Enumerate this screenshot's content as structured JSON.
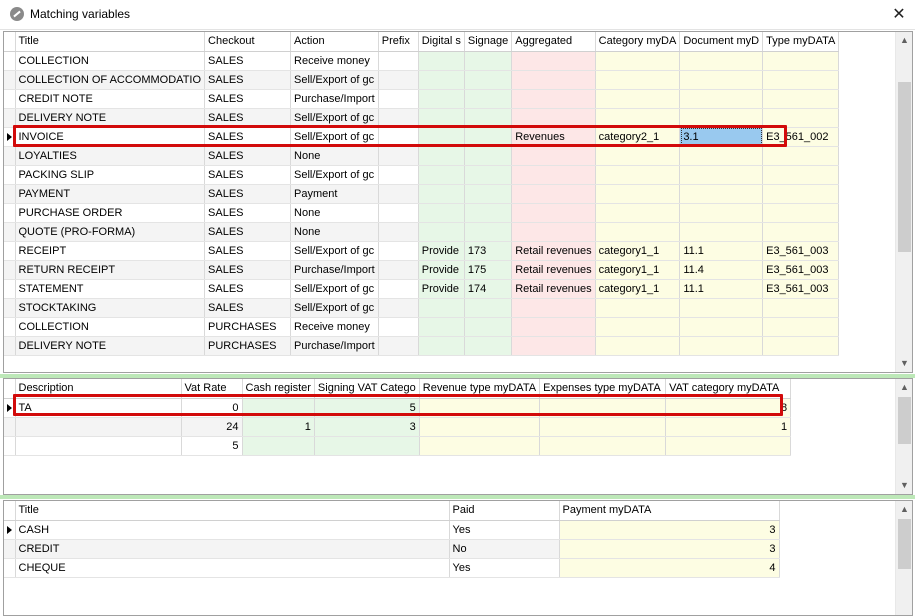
{
  "window": {
    "title": "Matching variables",
    "icon": "no-entry-icon",
    "close_glyph": "✕"
  },
  "documents": {
    "headers": [
      "Title",
      "Checkout",
      "Action",
      "Prefix",
      "Digital s",
      "Signage",
      "Aggregated",
      "Category myDA",
      "Document myD",
      "Type myDATA"
    ],
    "rows": [
      [
        "COLLECTION",
        "SALES",
        "Receive money",
        "",
        "",
        "",
        "",
        "",
        "",
        ""
      ],
      [
        "COLLECTION OF ACCOMMODATIO",
        "SALES",
        "Sell/Export of gc",
        "",
        "",
        "",
        "",
        "",
        "",
        ""
      ],
      [
        "CREDIT NOTE",
        "SALES",
        "Purchase/Import",
        "",
        "",
        "",
        "",
        "",
        "",
        ""
      ],
      [
        "DELIVERY NOTE",
        "SALES",
        "Sell/Export of gc",
        "",
        "",
        "",
        "",
        "",
        "",
        ""
      ],
      [
        "INVOICE",
        "SALES",
        "Sell/Export of gc",
        "",
        "",
        "",
        "Revenues",
        "category2_1",
        "3.1",
        "E3_561_002"
      ],
      [
        "LOYALTIES",
        "SALES",
        "None",
        "",
        "",
        "",
        "",
        "",
        "",
        ""
      ],
      [
        "PACKING SLIP",
        "SALES",
        "Sell/Export of gc",
        "",
        "",
        "",
        "",
        "",
        "",
        ""
      ],
      [
        "PAYMENT",
        "SALES",
        "Payment",
        "",
        "",
        "",
        "",
        "",
        "",
        ""
      ],
      [
        "PURCHASE ORDER",
        "SALES",
        "None",
        "",
        "",
        "",
        "",
        "",
        "",
        ""
      ],
      [
        "QUOTE (PRO-FORMA)",
        "SALES",
        "None",
        "",
        "",
        "",
        "",
        "",
        "",
        ""
      ],
      [
        "RECEIPT",
        "SALES",
        "Sell/Export of gc",
        "",
        "Provide",
        "173",
        "Retail revenues",
        "category1_1",
        "11.1",
        "E3_561_003"
      ],
      [
        "RETURN RECEIPT",
        "SALES",
        "Purchase/Import",
        "",
        "Provide",
        "175",
        "Retail revenues",
        "category1_1",
        "11.4",
        "E3_561_003"
      ],
      [
        "STATEMENT",
        "SALES",
        "Sell/Export of gc",
        "",
        "Provide",
        "174",
        "Retail revenues",
        "category1_1",
        "11.1",
        "E3_561_003"
      ],
      [
        "STOCKTAKING",
        "SALES",
        "Sell/Export of gc",
        "",
        "",
        "",
        "",
        "",
        "",
        ""
      ],
      [
        "COLLECTION",
        "PURCHASES",
        "Receive money",
        "",
        "",
        "",
        "",
        "",
        "",
        ""
      ],
      [
        "DELIVERY NOTE",
        "PURCHASES",
        "Purchase/Import",
        "",
        "",
        "",
        "",
        "",
        "",
        ""
      ]
    ],
    "current_row": 4
  },
  "vat": {
    "headers": [
      "Description",
      "Vat Rate",
      "Cash register",
      "Signing VAT Catego",
      "Revenue type myDATA",
      "Expenses type myDATA",
      "VAT category myDATA"
    ],
    "rows": [
      [
        "TA",
        "0",
        "",
        "5",
        "",
        "",
        "8"
      ],
      [
        "",
        "24",
        "1",
        "3",
        "",
        "",
        "1"
      ],
      [
        "",
        "5",
        "",
        "",
        "",
        "",
        ""
      ]
    ],
    "current_row": 0
  },
  "payments": {
    "headers": [
      "Title",
      "Paid",
      "Payment myDATA"
    ],
    "rows": [
      [
        "CASH",
        "Yes",
        "3"
      ],
      [
        "CREDIT",
        "No",
        "3"
      ],
      [
        "CHEQUE",
        "Yes",
        "4"
      ]
    ],
    "current_row": 0
  },
  "colors": {
    "green_cell": "#e7f7e7",
    "red_cell": "#fde7e7",
    "yellow_cell": "#fdfde3",
    "selection": "#99c9ef",
    "highlight_border": "#d20a0a",
    "separator": "#bde8b8"
  }
}
